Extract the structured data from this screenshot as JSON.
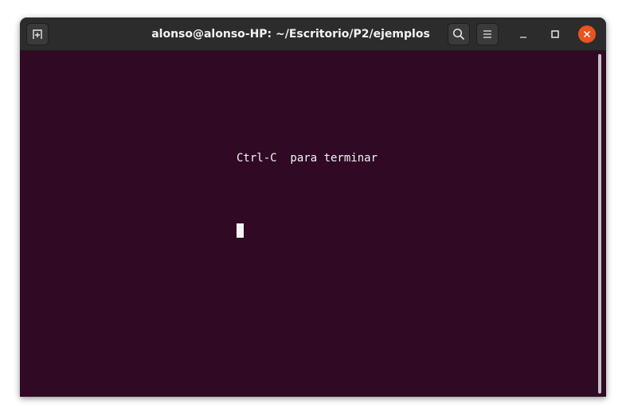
{
  "window": {
    "title": "alonso@alonso-HP: ~/Escritorio/P2/ejemplos"
  },
  "titlebar": {
    "new_tab_icon": "new-tab-icon",
    "search_icon": "search-icon",
    "menu_icon": "hamburger-menu-icon",
    "minimize_icon": "minimize-icon",
    "maximize_icon": "maximize-icon",
    "close_icon": "close-icon"
  },
  "terminal": {
    "lines": [
      "Ctrl-C  para terminar"
    ],
    "background_color": "#300a24",
    "text_color": "#f5f5f5"
  },
  "colors": {
    "titlebar": "#2c2c2c",
    "close_button": "#e95420"
  }
}
